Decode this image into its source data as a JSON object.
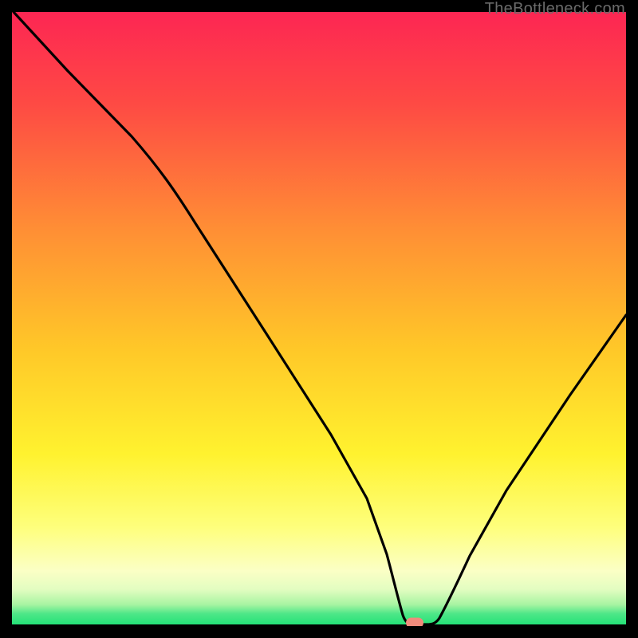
{
  "watermark": "TheBottleneck.com",
  "colors": {
    "top": "#fd2653",
    "mid_upper": "#fe8338",
    "mid": "#ffd626",
    "mid_lower": "#fffb5e",
    "pale": "#fdffc0",
    "green": "#23e37a",
    "marker": "#f08b7c",
    "line": "#000000",
    "frame": "#000000"
  },
  "chart_data": {
    "type": "line",
    "title": "",
    "xlabel": "",
    "ylabel": "",
    "xlim": [
      0,
      100
    ],
    "ylim": [
      0,
      100
    ],
    "x": [
      0,
      10,
      20,
      25,
      30,
      40,
      50,
      55,
      58,
      60,
      62,
      64,
      66,
      70,
      75,
      80,
      85,
      90,
      95,
      100
    ],
    "values": [
      100,
      90,
      80,
      75,
      69,
      53,
      37,
      26,
      15,
      5,
      1,
      0,
      0,
      1,
      7,
      17,
      27,
      38,
      47,
      55
    ],
    "marker_x": 65,
    "marker_y": 0,
    "notes": "V-shaped bottleneck curve; minimum (optimal match) occurs around x≈63–66 where value≈0. Background gradient runs from red (high bottleneck) at top through orange/yellow to green (no bottleneck) at bottom."
  }
}
